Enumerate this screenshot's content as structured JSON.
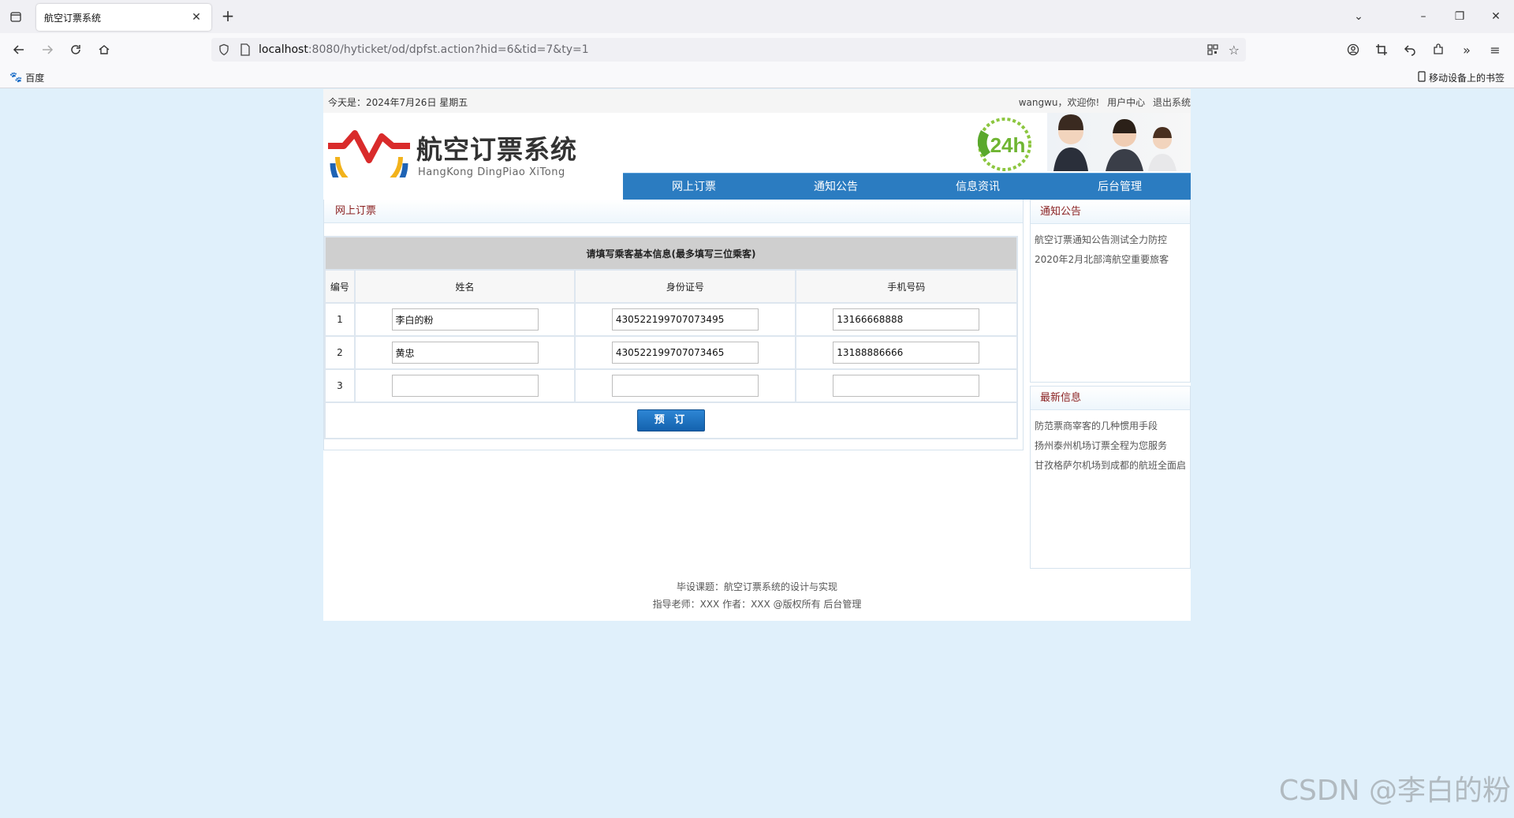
{
  "browser": {
    "tab_title": "航空订票系统",
    "url_host": "localhost",
    "url_rest": ":8080/hyticket/od/dpfst.action?hid=6&tid=7&ty=1",
    "bookmark_left": "百度",
    "bookmark_right": "移动设备上的书签"
  },
  "topline": {
    "date": "今天是：2024年7月26日 星期五",
    "welcome": "wangwu，欢迎你!",
    "user_center": "用户中心",
    "logout": "退出系统"
  },
  "logo": {
    "cn": "航空订票系统",
    "en": "HangKong DingPiao XiTong",
    "badge": "24h"
  },
  "mainnav": [
    "网上订票",
    "通知公告",
    "信息资讯",
    "后台管理"
  ],
  "content": {
    "panel_title": "网上订票",
    "caption": "请填写乘客基本信息(最多填写三位乘客)",
    "headers": [
      "编号",
      "姓名",
      "身份证号",
      "手机号码"
    ],
    "rows": [
      {
        "no": "1",
        "name": "李白的粉",
        "id": "430522199707073495",
        "phone": "13166668888"
      },
      {
        "no": "2",
        "name": "黄忠",
        "id": "430522199707073465",
        "phone": "13188886666"
      },
      {
        "no": "3",
        "name": "",
        "id": "",
        "phone": ""
      }
    ],
    "submit": "预 订"
  },
  "sidebar": {
    "notice_title": "通知公告",
    "notices": [
      "航空订票通知公告测试全力防控",
      "2020年2月北部湾航空重要旅客"
    ],
    "news_title": "最新信息",
    "news": [
      "防范票商宰客的几种惯用手段",
      "扬州泰州机场订票全程为您服务",
      "甘孜格萨尔机场到成都的航班全面启"
    ]
  },
  "footer": {
    "line1": "毕设课题：航空订票系统的设计与实现",
    "line2": "指导老师：XXX 作者：XXX @版权所有 后台管理"
  },
  "watermark": "CSDN @李白的粉",
  "colors": {
    "nav_blue": "#2b7cc1",
    "panel_title_red": "#8a1f1f",
    "page_bg": "#e0f0fb"
  }
}
